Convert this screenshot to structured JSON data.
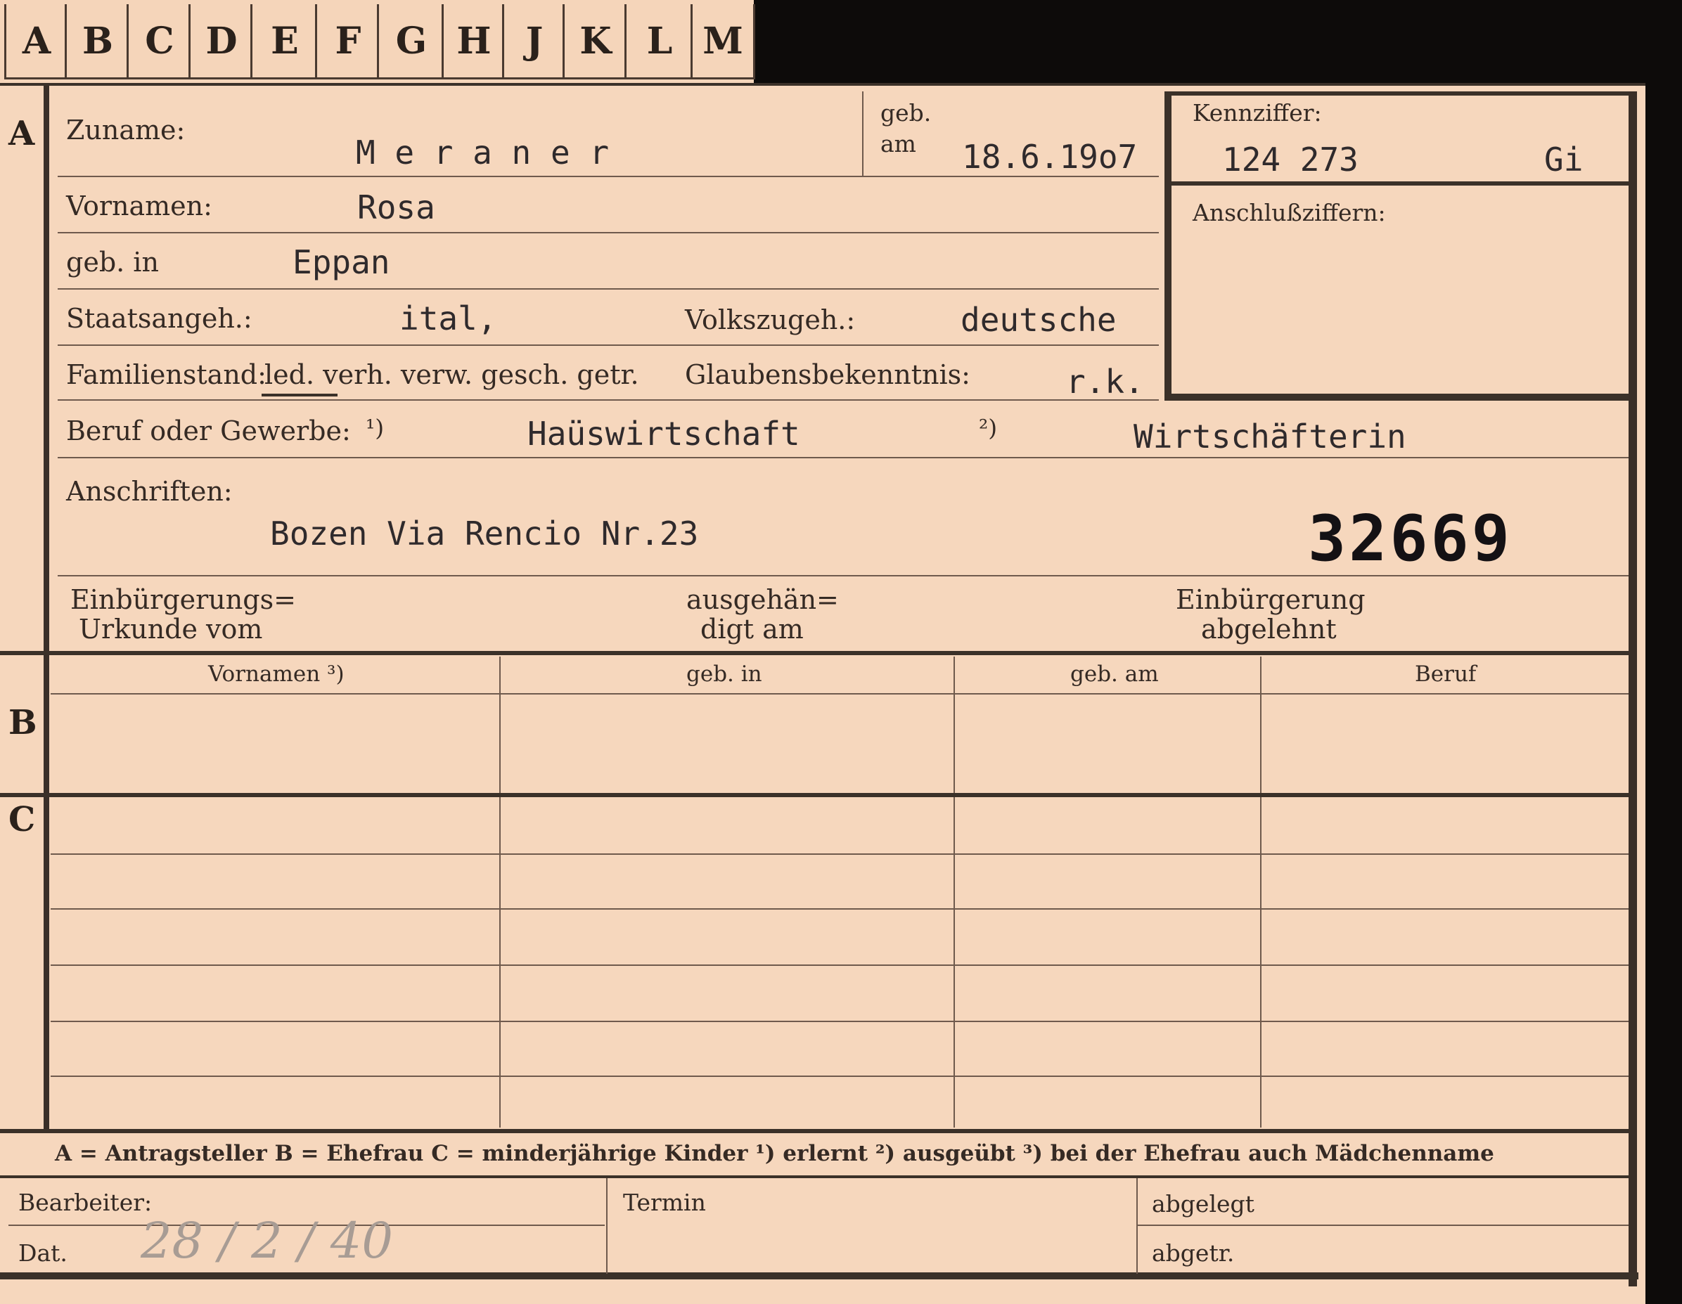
{
  "tabs": [
    "A",
    "B",
    "C",
    "D",
    "E",
    "F",
    "G",
    "H",
    "J",
    "K",
    "L",
    "M"
  ],
  "sections": {
    "a": "A",
    "b": "B",
    "c": "C"
  },
  "fields": {
    "surname_label": "Zuname:",
    "surname_value": "M e r a n e r",
    "birthdate_label_1": "geb.",
    "birthdate_label_2": "am",
    "birthdate_value": "18.6.19o7",
    "first_names_label": "Vornamen:",
    "first_names_value": "Rosa",
    "birthplace_label": "geb. in",
    "birthplace_value": "Eppan",
    "citizenship_label": "Staatsangeh.:",
    "citizenship_value": "ital,",
    "ethnicity_label": "Volkszugeh.:",
    "ethnicity_value": "deutsche",
    "marital_label": "Familienstand:",
    "marital_options": "led. verh. verw. gesch. getr.",
    "religion_label": "Glaubensbekenntnis:",
    "religion_value": "r.k.",
    "occupation_label": "Beruf oder Gewerbe:",
    "occupation_note1": "¹)",
    "occupation_value1": "Haüswirtschaft",
    "occupation_note2": "²)",
    "occupation_value2": "Wirtschäfterin",
    "address_label": "Anschriften:",
    "address_value": "Bozen Via Rencio  Nr.23",
    "file_number": "32669",
    "naturalization_label_1": "Einbürgerungs=",
    "naturalization_label_2": "Urkunde vom",
    "delivered_label_1": "ausgehän=",
    "delivered_label_2": "digt am",
    "rejected_label_1": "Einbürgerung",
    "rejected_label_2": "abgelehnt"
  },
  "id_box": {
    "label": "Kennziffer:",
    "value": "124 273",
    "suffix": "Gi",
    "connection_label": "Anschlußziffern:"
  },
  "family_table": {
    "headers": [
      "Vornamen ³)",
      "geb. in",
      "geb. am",
      "Beruf"
    ]
  },
  "legend": "A = Antragsteller   B = Ehefrau   C = minderjährige Kinder   ¹) erlernt   ²) ausgeübt   ³) bei der Ehefrau auch Mädchenname",
  "footer": {
    "clerk_label": "Bearbeiter:",
    "date_label": "Dat.",
    "date_handwritten": "28 / 2 / 40",
    "deadline_label": "Termin",
    "filed_label": "abgelegt",
    "sent_label": "abgetr."
  }
}
